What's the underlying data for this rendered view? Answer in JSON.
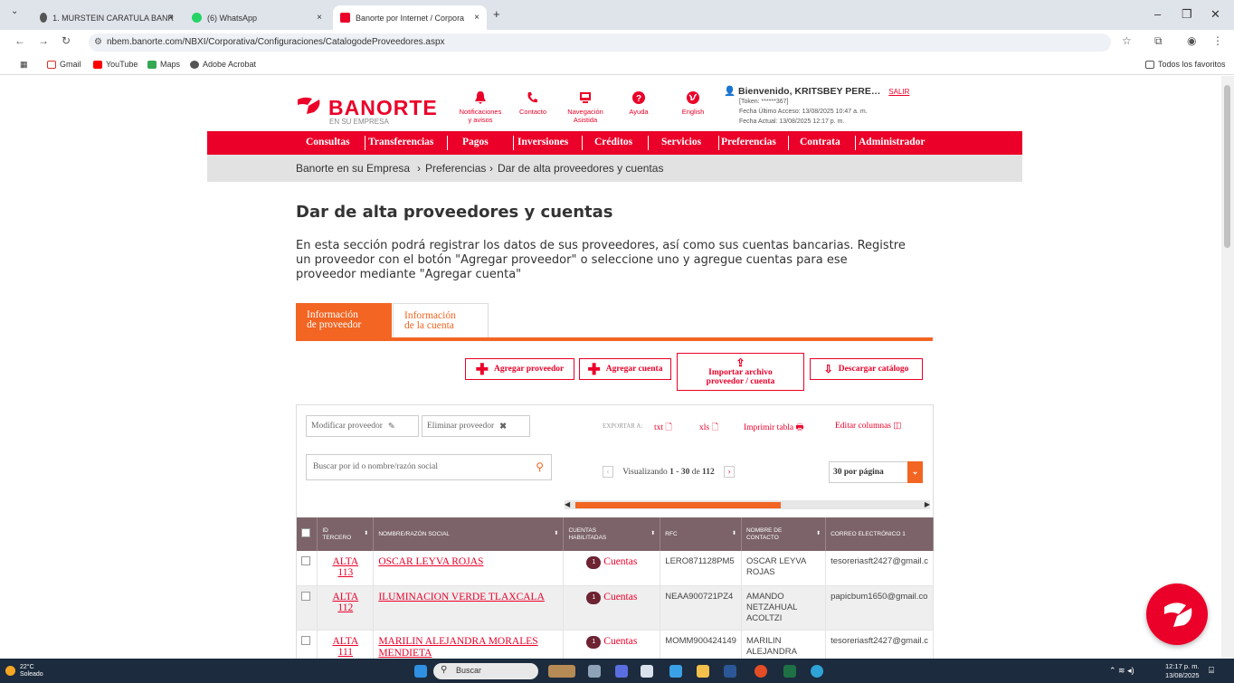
{
  "browser": {
    "tabs": [
      {
        "label": "1. MURSTEIN CARATULA BANR",
        "close": "×"
      },
      {
        "label": "(6) WhatsApp",
        "close": "×"
      },
      {
        "label": "Banorte por Internet / Corpora",
        "close": "×"
      }
    ],
    "new_tab": "+",
    "url": "nbem.banorte.com/NBXI/Corporativa/Configuraciones/CatalogodeProveedores.aspx",
    "bookmarks": [
      "Gmail",
      "YouTube",
      "Maps",
      "Adobe Acrobat"
    ],
    "all_bookmarks": "Todos los favoritos"
  },
  "header": {
    "brand": "BANORTE",
    "brand_sub": "EN SU EMPRESA",
    "icons": [
      {
        "label1": "Notificaciones",
        "label2": "y avisos",
        "icon": "bell-icon"
      },
      {
        "label1": "Contacto",
        "label2": "",
        "icon": "phone-icon"
      },
      {
        "label1": "Navegación",
        "label2": "Asistida",
        "icon": "monitor-icon"
      },
      {
        "label1": "Ayuda",
        "label2": "",
        "icon": "help-icon"
      },
      {
        "label1": "English",
        "label2": "",
        "icon": "globe-icon"
      }
    ],
    "welcome": "Bienvenido, KRITSBEY PERE…",
    "logout": "SALIR",
    "token": "[Token: ******367]",
    "last_access": "Fecha Último Acceso: 13/08/2025 10:47 a. m.",
    "current_date": "Fecha Actual: 13/08/2025 12:17 p. m."
  },
  "nav": [
    "Consultas",
    "Transferencias",
    "Pagos",
    "Inversiones",
    "Créditos",
    "Servicios",
    "Preferencias",
    "Contrata",
    "Administrador"
  ],
  "breadcrumb": [
    "Banorte en su Empresa",
    "Preferencias",
    "Dar de alta proveedores y cuentas"
  ],
  "breadcrumb_sep": "›",
  "page": {
    "title": "Dar de alta proveedores y cuentas",
    "intro": "En esta sección podrá registrar los datos de sus proveedores, así como sus cuentas bancarias. Registre un proveedor con el botón \"Agregar proveedor\" o seleccione uno y agregue cuentas para ese proveedor mediante \"Agregar cuenta\"",
    "tabs": [
      {
        "l1": "Información",
        "l2": "de proveedor"
      },
      {
        "l1": "Información",
        "l2": "de la cuenta"
      }
    ],
    "actions": {
      "add_provider": "Agregar proveedor",
      "add_account": "Agregar cuenta",
      "import_l1": "Importar archivo",
      "import_l2": "proveedor / cuenta",
      "download": "Descargar catálogo"
    },
    "toolbar": {
      "modify": "Modificar proveedor",
      "delete": "Eliminar proveedor",
      "export_label": "EXPORTAR A:",
      "txt": "txt",
      "xls": "xls",
      "print": "Imprimir tabla",
      "edit_cols": "Editar columnas"
    },
    "search_placeholder": "Buscar por id o nombre/razón social",
    "pager": {
      "prefix": "Visualizando",
      "from": "1",
      "dash": "-",
      "to": "30",
      "of": "de",
      "total": "112"
    },
    "per_page": "30 por página",
    "columns": [
      {
        "l1": "ID",
        "l2": "TERCERO"
      },
      {
        "l1": "NOMBRE/RAZÓN SOCIAL",
        "l2": ""
      },
      {
        "l1": "CUENTAS",
        "l2": "HABILITADAS"
      },
      {
        "l1": "RFC",
        "l2": ""
      },
      {
        "l1": "NOMBRE DE",
        "l2": "CONTACTO"
      },
      {
        "l1": "CORREO ELECTRÓNICO 1",
        "l2": ""
      }
    ],
    "rows": [
      {
        "id1": "ALTA",
        "id2": "113",
        "name1": "OSCAR LEYVA ROJAS",
        "name2": "",
        "badge": "1",
        "cuentas": "Cuentas",
        "rfc": "LERO871128PM5",
        "c1": "OSCAR LEYVA",
        "c2": "ROJAS",
        "c3": "",
        "email": "tesoreriasft2427@gmail.c"
      },
      {
        "id1": "ALTA",
        "id2": "112",
        "name1": "ILUMINACION VERDE TLAXCALA",
        "name2": "",
        "badge": "1",
        "cuentas": "Cuentas",
        "rfc": "NEAA900721PZ4",
        "c1": "AMANDO",
        "c2": "NETZAHUAL",
        "c3": "ACOLTZI",
        "email": "papicbum1650@gmail.co"
      },
      {
        "id1": "ALTA",
        "id2": "111",
        "name1": "MARILIN ALEJANDRA MORALES",
        "name2": "MENDIETA",
        "badge": "1",
        "cuentas": "Cuentas",
        "rfc": "MOMM900424149",
        "c1": "MARILIN",
        "c2": "ALEJANDRA",
        "c3": "",
        "email": "tesoreriasft2427@gmail.c"
      }
    ]
  },
  "taskbar": {
    "temp": "22°C",
    "weather": "Soleado",
    "search": "Buscar",
    "time": "12:17 p. m.",
    "date": "13/08/2025"
  },
  "colors": {
    "brand_red": "#eb0029",
    "orange": "#f26522",
    "header_maroon": "#7b6369"
  }
}
